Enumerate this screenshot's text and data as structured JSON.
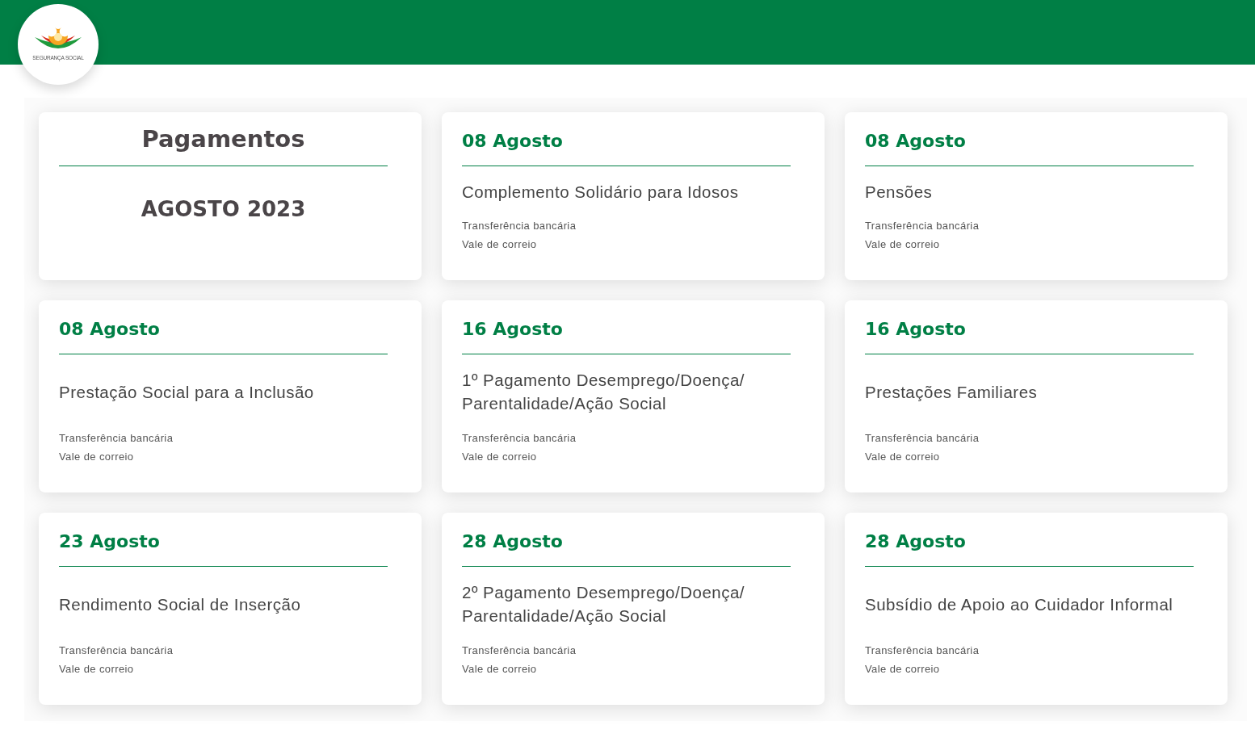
{
  "logo": {
    "text": "SEGURANÇA SOCIAL"
  },
  "cards": [
    {
      "kind": "intro",
      "title": "Pagamentos",
      "subtitle": "AGOSTO 2023"
    },
    {
      "kind": "payment",
      "date": "08 Agosto",
      "title": "Complemento Solidário para Idosos",
      "methods": [
        "Transferência bancária",
        "Vale de correio"
      ]
    },
    {
      "kind": "payment",
      "date": "08 Agosto",
      "title": "Pensões",
      "methods": [
        "Transferência bancária",
        "Vale de correio"
      ]
    },
    {
      "kind": "payment",
      "date": "08 Agosto",
      "title": "Prestação Social para a Inclusão",
      "methods": [
        "Transferência bancária",
        "Vale de correio"
      ]
    },
    {
      "kind": "payment",
      "date": "16 Agosto",
      "title": "1º Pagamento Desemprego/Doença/ Parentalidade/Ação Social",
      "methods": [
        "Transferência bancária",
        "Vale de correio"
      ]
    },
    {
      "kind": "payment",
      "date": "16 Agosto",
      "title": "Prestações Familiares",
      "methods": [
        "Transferência bancária",
        "Vale de correio"
      ]
    },
    {
      "kind": "payment",
      "date": "23 Agosto",
      "title": "Rendimento Social de Inserção",
      "methods": [
        "Transferência bancária",
        "Vale de correio"
      ]
    },
    {
      "kind": "payment",
      "date": "28 Agosto",
      "title": "2º Pagamento Desemprego/Doença/ Parentalidade/Ação Social",
      "methods": [
        "Transferência bancária",
        "Vale de correio"
      ]
    },
    {
      "kind": "payment",
      "date": "28 Agosto",
      "title": "Subsídio de Apoio ao Cuidador Informal",
      "methods": [
        "Transferência bancária",
        "Vale de correio"
      ]
    }
  ]
}
